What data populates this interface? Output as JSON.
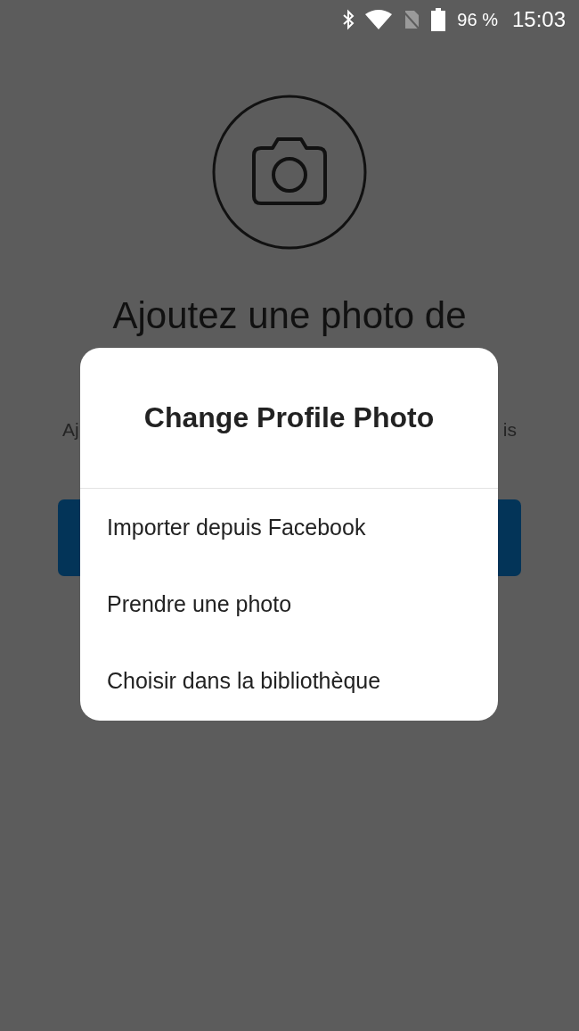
{
  "status_bar": {
    "battery": "96 %",
    "time": "15:03"
  },
  "screen": {
    "heading": "Ajoutez une photo de",
    "subtitle_left": "Aj",
    "subtitle_right": "is"
  },
  "dialog": {
    "title": "Change Profile Photo",
    "options": [
      "Importer depuis Facebook",
      "Prendre une photo",
      "Choisir dans la bibliothèque"
    ]
  }
}
